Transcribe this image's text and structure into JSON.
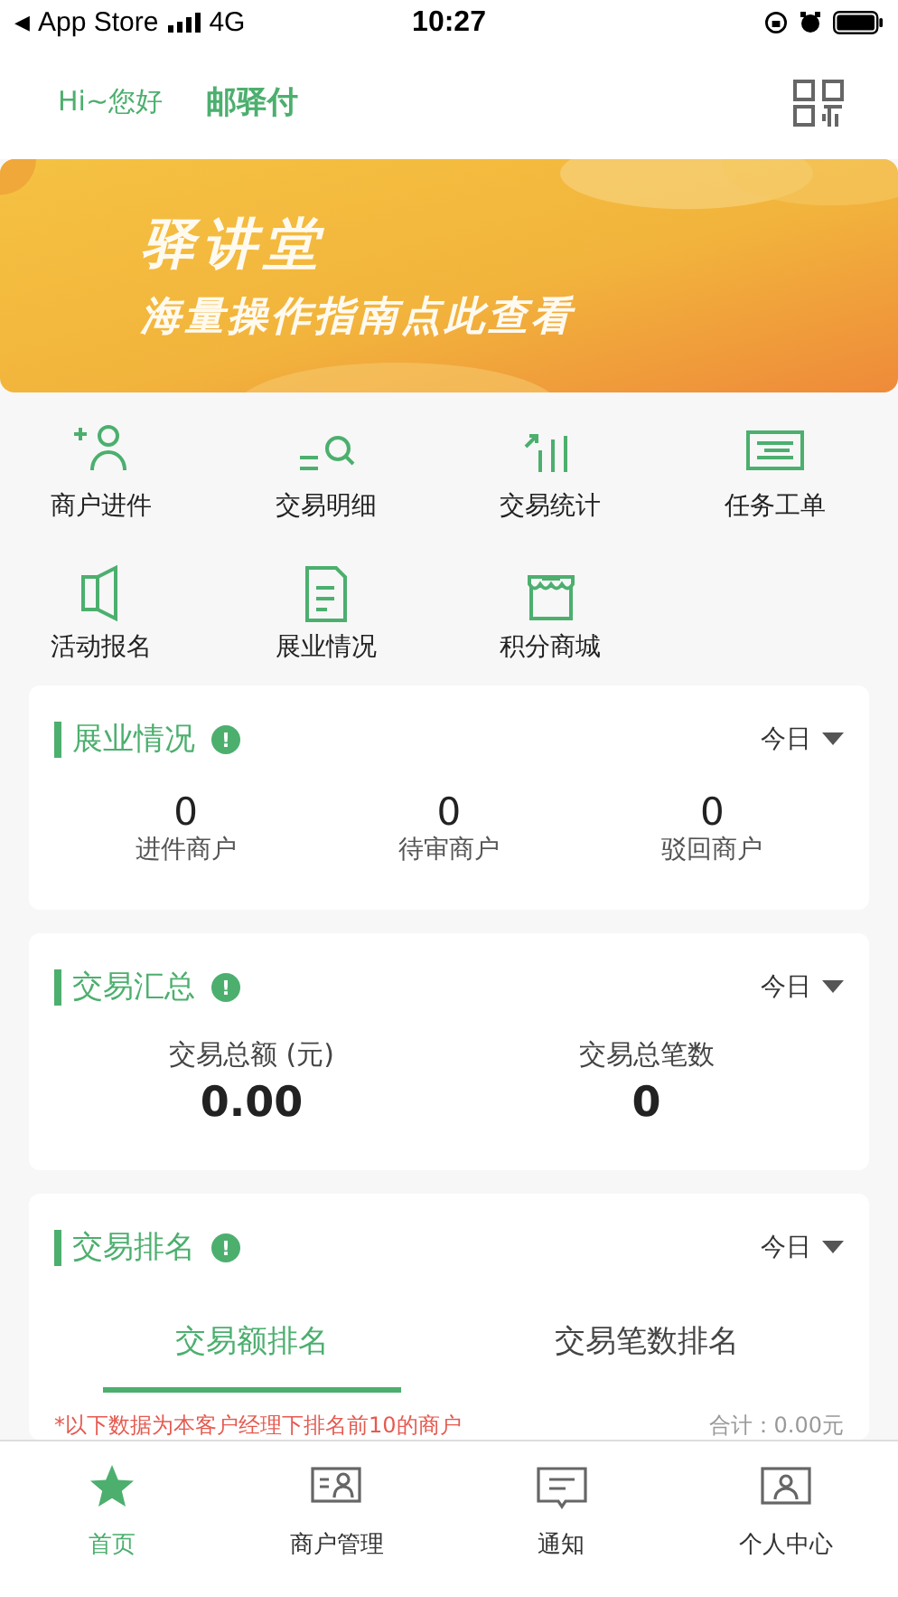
{
  "status_bar": {
    "back": "◀",
    "carrier": "App Store",
    "network": "4G",
    "time": "10:27"
  },
  "header": {
    "greeting": "Hi~您好",
    "title": "邮驿付"
  },
  "banner": {
    "title": "驿讲堂",
    "subtitle": "海量操作指南点此查看"
  },
  "shortcuts": [
    {
      "label": "商户进件"
    },
    {
      "label": "交易明细"
    },
    {
      "label": "交易统计"
    },
    {
      "label": "任务工单"
    },
    {
      "label": "活动报名"
    },
    {
      "label": "展业情况"
    },
    {
      "label": "积分商城"
    }
  ],
  "business": {
    "title": "展业情况",
    "info": "!",
    "period": "今日",
    "stats": [
      {
        "value": "0",
        "label": "进件商户"
      },
      {
        "value": "0",
        "label": "待审商户"
      },
      {
        "value": "0",
        "label": "驳回商户"
      }
    ]
  },
  "summary": {
    "title": "交易汇总",
    "info": "!",
    "period": "今日",
    "stats": [
      {
        "label": "交易总额 (元)",
        "value": "0.00"
      },
      {
        "label": "交易总笔数",
        "value": "0"
      }
    ]
  },
  "ranking": {
    "title": "交易排名",
    "info": "!",
    "period": "今日",
    "tabs": [
      {
        "label": "交易额排名",
        "selected": true
      },
      {
        "label": "交易笔数排名",
        "selected": false
      }
    ],
    "note": "*以下数据为本客户经理下排名前10的商户",
    "total": "合计：0.00元"
  },
  "tab_bar": [
    {
      "label": "首页",
      "selected": true
    },
    {
      "label": "商户管理",
      "selected": false
    },
    {
      "label": "通知",
      "selected": false
    },
    {
      "label": "个人中心",
      "selected": false
    }
  ]
}
